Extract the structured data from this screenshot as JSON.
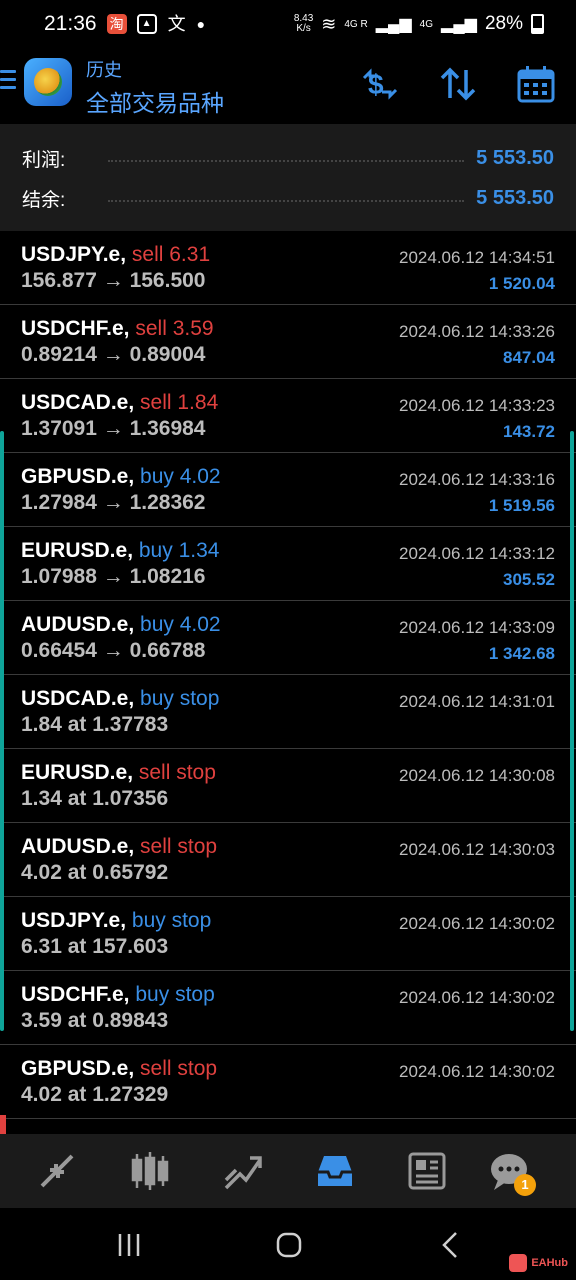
{
  "status_bar": {
    "time": "21:36",
    "net_speed": "8.43",
    "net_unit": "K/s",
    "network_4g": "4G",
    "network_4g_r": "4G R",
    "battery": "28%"
  },
  "header": {
    "subtitle": "历史",
    "title": "全部交易品种",
    "accent": "#3a8fe6"
  },
  "summary": {
    "profit_label": "利润:",
    "profit_value": "5 553.50",
    "balance_label": "结余:",
    "balance_value": "5 553.50"
  },
  "rows": [
    {
      "symbol": "USDJPY.e,",
      "action": "sell 6.31",
      "action_color": "red",
      "prices": "156.877 → 156.500",
      "time": "2024.06.12 14:34:51",
      "profit": "1 520.04"
    },
    {
      "symbol": "USDCHF.e,",
      "action": "sell 3.59",
      "action_color": "red",
      "prices": "0.89214 → 0.89004",
      "time": "2024.06.12 14:33:26",
      "profit": "847.04"
    },
    {
      "symbol": "USDCAD.e,",
      "action": "sell 1.84",
      "action_color": "red",
      "prices": "1.37091 → 1.36984",
      "time": "2024.06.12 14:33:23",
      "profit": "143.72"
    },
    {
      "symbol": "GBPUSD.e,",
      "action": "buy 4.02",
      "action_color": "blue",
      "prices": "1.27984 → 1.28362",
      "time": "2024.06.12 14:33:16",
      "profit": "1 519.56"
    },
    {
      "symbol": "EURUSD.e,",
      "action": "buy 1.34",
      "action_color": "blue",
      "prices": "1.07988 → 1.08216",
      "time": "2024.06.12 14:33:12",
      "profit": "305.52"
    },
    {
      "symbol": "AUDUSD.e,",
      "action": "buy 4.02",
      "action_color": "blue",
      "prices": "0.66454 → 0.66788",
      "time": "2024.06.12 14:33:09",
      "profit": "1 342.68"
    },
    {
      "symbol": "USDCAD.e,",
      "action": "buy stop",
      "action_color": "blue",
      "prices": "1.84 at 1.37783",
      "time": "2024.06.12 14:31:01",
      "profit": ""
    },
    {
      "symbol": "EURUSD.e,",
      "action": "sell stop",
      "action_color": "red",
      "prices": "1.34 at 1.07356",
      "time": "2024.06.12 14:30:08",
      "profit": ""
    },
    {
      "symbol": "AUDUSD.e,",
      "action": "sell stop",
      "action_color": "red",
      "prices": "4.02 at 0.65792",
      "time": "2024.06.12 14:30:03",
      "profit": ""
    },
    {
      "symbol": "USDJPY.e,",
      "action": "buy stop",
      "action_color": "blue",
      "prices": "6.31 at 157.603",
      "time": "2024.06.12 14:30:02",
      "profit": ""
    },
    {
      "symbol": "USDCHF.e,",
      "action": "buy stop",
      "action_color": "blue",
      "prices": "3.59 at 0.89843",
      "time": "2024.06.12 14:30:02",
      "profit": ""
    },
    {
      "symbol": "GBPUSD.e,",
      "action": "sell stop",
      "action_color": "red",
      "prices": "4.02 at 1.27329",
      "time": "2024.06.12 14:30:02",
      "profit": ""
    }
  ],
  "bottom_nav": {
    "items": [
      "quotes-icon",
      "chart-icon",
      "trade-icon",
      "history-icon",
      "news-icon",
      "chat-icon"
    ],
    "chat_badge": "1"
  },
  "watermark": "EAHub"
}
